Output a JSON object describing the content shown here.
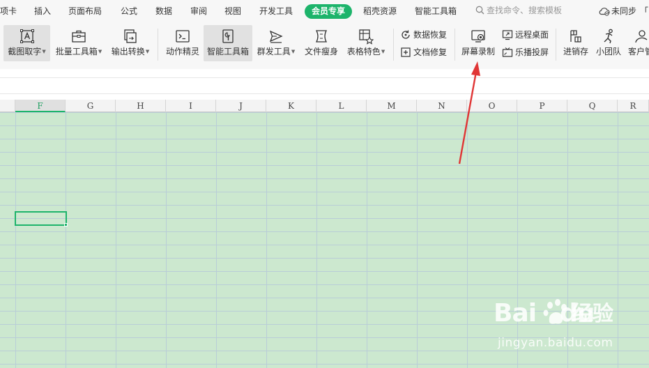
{
  "menubar": {
    "items": [
      "项卡",
      "插入",
      "页面布局",
      "公式",
      "数据",
      "审阅",
      "视图",
      "开发工具"
    ],
    "active": "会员专享",
    "after": [
      "稻壳资源",
      "智能工具箱"
    ],
    "search_placeholder": "查找命令、搜索模板",
    "sync_label": "未同步",
    "more_label": "「"
  },
  "ribbon": {
    "buttons": [
      {
        "label": "截图取字",
        "icon": "screenshot-text-icon"
      },
      {
        "label": "批量工具箱",
        "icon": "toolbox-icon"
      },
      {
        "label": "输出转换",
        "icon": "output-convert-icon"
      },
      {
        "label": "动作精灵",
        "icon": "terminal-icon"
      },
      {
        "label": "智能工具箱",
        "icon": "smart-toolbox-icon"
      },
      {
        "label": "群发工具",
        "icon": "mass-send-icon"
      },
      {
        "label": "文件瘦身",
        "icon": "file-slim-icon"
      },
      {
        "label": "表格特色",
        "icon": "table-feature-icon"
      },
      {
        "label": "屏幕录制",
        "icon": "screen-record-icon"
      },
      {
        "label": "进销存",
        "icon": "inventory-icon"
      },
      {
        "label": "小团队",
        "icon": "team-icon"
      },
      {
        "label": "客户管",
        "icon": "customer-icon"
      }
    ],
    "small": [
      {
        "label": "数据恢复",
        "icon": "data-recovery-icon"
      },
      {
        "label": "文档修复",
        "icon": "doc-repair-icon"
      },
      {
        "label": "远程桌面",
        "icon": "remote-desktop-icon"
      },
      {
        "label": "乐播投屏",
        "icon": "screen-cast-icon"
      }
    ]
  },
  "columns": [
    "F",
    "G",
    "H",
    "I",
    "J",
    "K",
    "L",
    "M",
    "N",
    "O",
    "P",
    "Q",
    "R"
  ],
  "selected_cell": "F",
  "colors": {
    "accent": "#1db46b",
    "grid_bg": "#cce8cf",
    "arrow": "#e03535"
  },
  "watermark": {
    "logo": "Bai",
    "logo2": "du",
    "cn": "经验",
    "url": "jingyan.baidu.com"
  }
}
